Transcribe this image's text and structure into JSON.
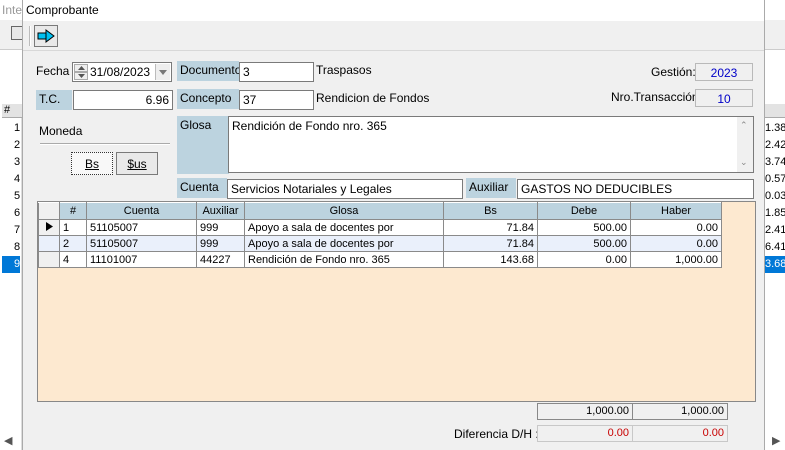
{
  "background": {
    "title_fragment": "Inte",
    "left_header": "#",
    "left_rows": [
      "1",
      "2",
      "3",
      "4",
      "5",
      "6",
      "7",
      "8",
      "9"
    ],
    "right_rows": [
      "1.38",
      "2.42",
      "3.74",
      "0.57",
      "0.03",
      "1.85",
      "2.41",
      "6.41",
      "3.68"
    ],
    "selected_index": 8
  },
  "window": {
    "title": "Comprobante"
  },
  "toolbar": {
    "go_icon": "arrow-right-icon"
  },
  "form": {
    "fecha_label": "Fecha",
    "fecha_value": "31/08/2023",
    "tc_label": "T.C.",
    "tc_value": "6.96",
    "documento_label": "Documento",
    "documento_value": "3",
    "documento_type": "Traspasos",
    "concepto_label": "Concepto",
    "concepto_value": "37",
    "concepto_desc": "Rendicion de Fondos",
    "gestion_label": "Gestión:",
    "gestion_value": "2023",
    "nro_label": "Nro.Transacción",
    "nro_value": "10",
    "moneda_label": "Moneda",
    "bs_button": "Bs",
    "sus_button": "$us",
    "glosa_label": "Glosa",
    "glosa_value": "Rendición de Fondo nro. 365",
    "cuenta_label": "Cuenta",
    "cuenta_value": "Servicios Notariales y Legales",
    "auxiliar_label": "Auxiliar",
    "auxiliar_value": "GASTOS NO DEDUCIBLES"
  },
  "grid": {
    "columns": [
      "#",
      "Cuenta",
      "Auxiliar",
      "Glosa",
      "Bs",
      "Debe",
      "Haber"
    ],
    "rows": [
      {
        "n": "1",
        "cuenta": "51105007",
        "auxiliar": "999",
        "glosa": "Apoyo a sala de docentes por",
        "bs": "71.84",
        "debe": "500.00",
        "haber": "0.00"
      },
      {
        "n": "2",
        "cuenta": "51105007",
        "auxiliar": "999",
        "glosa": "Apoyo a sala de docentes por",
        "bs": "71.84",
        "debe": "500.00",
        "haber": "0.00"
      },
      {
        "n": "4",
        "cuenta": "11101007",
        "auxiliar": "44227",
        "glosa": "Rendición de Fondo nro. 365",
        "bs": "143.68",
        "debe": "0.00",
        "haber": "1,000.00"
      }
    ]
  },
  "totals": {
    "debe": "1,000.00",
    "haber": "1,000.00",
    "diferencia_label": "Diferencia D/H :",
    "dif_debe": "0.00",
    "dif_haber": "0.00"
  }
}
